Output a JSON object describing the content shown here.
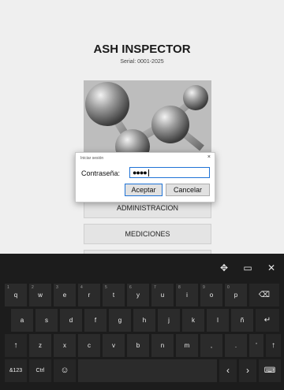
{
  "app": {
    "title": "ASH INSPECTOR",
    "serial": "Serial: 0001-2025"
  },
  "menu": {
    "administracion": "ADMINISTRACION",
    "mediciones": "MEDICIONES"
  },
  "dialog": {
    "title": "Iniciar sesión",
    "close": "×",
    "password_label": "Contraseña:",
    "password_value": "●●●●",
    "ok_label": "Aceptar",
    "cancel_label": "Cancelar"
  },
  "keyboard": {
    "toolbar": {
      "move": "✥",
      "dock": "▭",
      "close": "✕"
    },
    "row1": [
      {
        "label": "q",
        "hint": "1"
      },
      {
        "label": "w",
        "hint": "2"
      },
      {
        "label": "e",
        "hint": "3"
      },
      {
        "label": "r",
        "hint": "4"
      },
      {
        "label": "t",
        "hint": "5"
      },
      {
        "label": "y",
        "hint": "6"
      },
      {
        "label": "u",
        "hint": "7"
      },
      {
        "label": "i",
        "hint": "8"
      },
      {
        "label": "o",
        "hint": "9"
      },
      {
        "label": "p",
        "hint": "0"
      }
    ],
    "backspace": "⌫",
    "row2": [
      "a",
      "s",
      "d",
      "f",
      "g",
      "h",
      "j",
      "k",
      "l",
      "ñ"
    ],
    "enter": "↵",
    "shift": "↑",
    "row3": [
      "z",
      "x",
      "c",
      "v",
      "b",
      "n",
      "m",
      ",",
      ".",
      "'"
    ],
    "shift_right": "↑",
    "symbols": "&123",
    "ctrl": "Ctrl",
    "emoji": "☺",
    "space": "",
    "left": "‹",
    "right": "›",
    "layout": "⌨"
  },
  "colors": {
    "background": "#efefef",
    "keyboard_bg": "#1c1c1c",
    "key_bg": "#2b2b2b",
    "accent": "#1f73d6"
  }
}
